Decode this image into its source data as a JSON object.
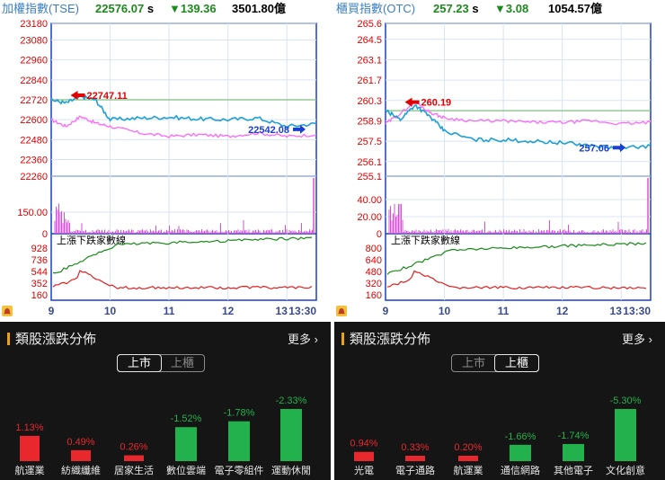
{
  "colors": {
    "up": "#e8282d",
    "down": "#22b14c",
    "index_line": "#1e9fd6",
    "unweighted_line": "#ff66ff",
    "ref_line": "#7fbf7f",
    "volume": "#d94fd9",
    "adv_line": "#1a8a1a",
    "dec_line": "#e02020",
    "axis_label": "#e00000",
    "frame": "#1a3fd0"
  },
  "left": {
    "header": {
      "name": "加權指數(TSE)",
      "price": "22576.07",
      "price_suffix": "s",
      "change": "▼139.36",
      "volume": "3501.80",
      "volume_unit": "億"
    },
    "annotations": {
      "high": "22747.11",
      "last": "22542.08"
    },
    "volume_panel": {
      "ticks": [
        "150.00",
        "0"
      ]
    },
    "breadth_panel": {
      "label": "上漲下跌家數線",
      "ticks": [
        "928",
        "736",
        "544",
        "352",
        "160"
      ]
    },
    "x_ticks": [
      "9",
      "10",
      "11",
      "12",
      "13",
      "13:30"
    ],
    "bottom": {
      "title": "類股漲跌分佈",
      "more": "更多",
      "tabs": [
        {
          "label": "上市",
          "active": true
        },
        {
          "label": "上櫃",
          "active": false
        }
      ]
    }
  },
  "right": {
    "header": {
      "name": "櫃買指數(OTC)",
      "price": "257.23",
      "price_suffix": "s",
      "change": "▼3.08",
      "volume": "1054.57",
      "volume_unit": "億"
    },
    "annotations": {
      "high": "260.19",
      "last": "257.06"
    },
    "volume_panel": {
      "ticks": [
        "40.00",
        "20.00",
        "0"
      ]
    },
    "breadth_panel": {
      "label": "上漲下跌家數線",
      "ticks": [
        "800",
        "640",
        "480",
        "320",
        "160"
      ]
    },
    "x_ticks": [
      "9",
      "10",
      "11",
      "12",
      "13",
      "13:30"
    ],
    "bottom": {
      "title": "類股漲跌分佈",
      "more": "更多",
      "tabs": [
        {
          "label": "上市",
          "active": false
        },
        {
          "label": "上櫃",
          "active": true
        }
      ]
    }
  },
  "chart_data": [
    {
      "type": "line",
      "title": "加權指數(TSE)",
      "ylim": [
        22260,
        23180
      ],
      "yticks": [
        "23180",
        "23080",
        "22960",
        "22840",
        "22720",
        "22600",
        "22480",
        "22360",
        "22260"
      ],
      "x": [
        9,
        9.25,
        9.5,
        9.75,
        10,
        10.5,
        11,
        11.5,
        12,
        12.5,
        13,
        13.5
      ],
      "series": [
        {
          "name": "加權指數",
          "values": [
            22720,
            22700,
            22740,
            22720,
            22600,
            22610,
            22615,
            22605,
            22600,
            22610,
            22560,
            22576
          ]
        },
        {
          "values": [
            22600,
            22560,
            22620,
            22580,
            22560,
            22520,
            22500,
            22510,
            22500,
            22520,
            22500,
            22510
          ]
        }
      ]
    },
    {
      "type": "line",
      "title": "櫃買指數(OTC)",
      "ylim": [
        255.1,
        265.6
      ],
      "yticks": [
        "265.6",
        "264.5",
        "263.1",
        "261.7",
        "260.3",
        "258.9",
        "257.5",
        "256.1",
        "255.1"
      ],
      "x": [
        9,
        9.25,
        9.5,
        9.75,
        10,
        10.5,
        11,
        11.5,
        12,
        12.5,
        13,
        13.5
      ],
      "series": [
        {
          "name": "櫃買指數",
          "values": [
            259.6,
            259.0,
            260.0,
            259.2,
            258.2,
            257.6,
            257.6,
            257.5,
            257.4,
            257.2,
            257.0,
            257.2
          ]
        },
        {
          "values": [
            258.7,
            259.4,
            260.2,
            259.5,
            259.1,
            258.9,
            258.9,
            258.8,
            258.8,
            258.9,
            258.7,
            258.8
          ]
        }
      ]
    },
    {
      "type": "bar",
      "title": "類股漲跌分佈 上市",
      "categories": [
        "航運業",
        "紡織纖維",
        "居家生活",
        "數位雲端",
        "電子零組件",
        "運動休閒"
      ],
      "values": [
        1.13,
        0.49,
        0.26,
        -1.52,
        -1.78,
        -2.33
      ],
      "labels": [
        "1.13%",
        "0.49%",
        "0.26%",
        "-1.52%",
        "-1.78%",
        "-2.33%"
      ]
    },
    {
      "type": "bar",
      "title": "類股漲跌分佈 上櫃",
      "categories": [
        "光電",
        "電子通路",
        "航運業",
        "通信網路",
        "其他電子",
        "文化創意"
      ],
      "values": [
        0.94,
        0.33,
        0.2,
        -1.66,
        -1.74,
        -5.3
      ],
      "labels": [
        "0.94%",
        "0.33%",
        "0.20%",
        "-1.66%",
        "-1.74%",
        "-5.30%"
      ]
    }
  ]
}
